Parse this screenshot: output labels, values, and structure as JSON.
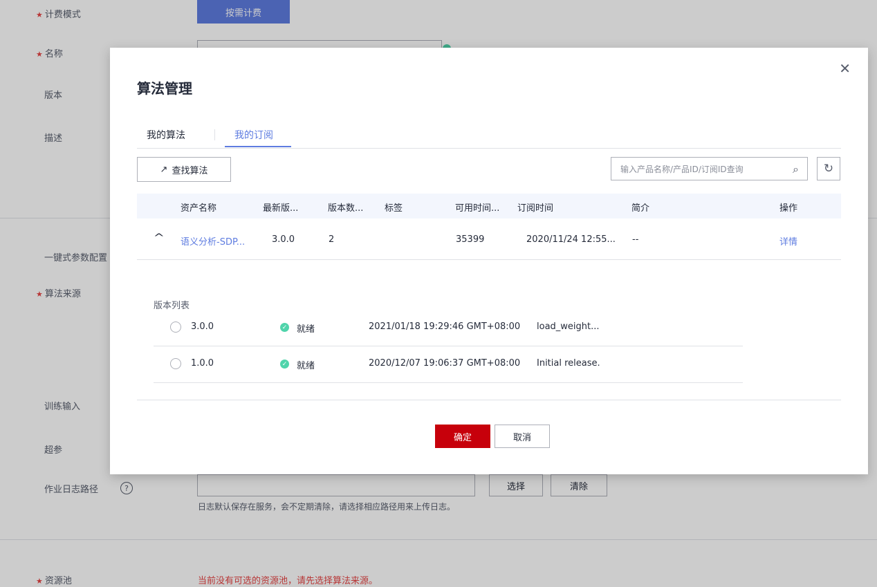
{
  "form": {
    "billing_label": "计费模式",
    "billing_button": "按需计费",
    "name_label": "名称",
    "version_label": "版本",
    "desc_label": "描述",
    "oneclick_label": "一键式参数配置",
    "algo_source_label": "算法来源",
    "train_input_label": "训练输入",
    "hyperparam_label": "超参",
    "log_path_label": "作业日志路径",
    "select_button": "选择",
    "clear_button": "清除",
    "log_hint": "日志默认保存在服务，会不定期清除，请选择相应路径用来上传日志。",
    "resource_pool_label": "资源池",
    "resource_pool_error": "当前没有可选的资源池，请先选择算法来源。"
  },
  "modal": {
    "title": "算法管理",
    "tabs": [
      {
        "label": "我的算法",
        "active": false
      },
      {
        "label": "我的订阅",
        "active": true
      }
    ],
    "find_button": "查找算法",
    "search_placeholder": "输入产品名称/产品ID/订阅ID查询",
    "columns": [
      "资产名称",
      "最新版...",
      "版本数...",
      "标签",
      "可用时间...",
      "订阅时间",
      "简介",
      "操作"
    ],
    "row": {
      "name": "语义分析-SDP...",
      "latest_version": "3.0.0",
      "version_count": "2",
      "tag": "",
      "available_time": "35399",
      "subscribe_time": "2020/11/24 12:55...",
      "intro": "--",
      "action": "详情"
    },
    "version_list_label": "版本列表",
    "versions": [
      {
        "version": "3.0.0",
        "status": "就绪",
        "time": "2021/01/18 19:29:46 GMT+08:00",
        "desc": "load_weight..."
      },
      {
        "version": "1.0.0",
        "status": "就绪",
        "time": "2020/12/07 19:06:37 GMT+08:00",
        "desc": "Initial release."
      }
    ],
    "ok_button": "确定",
    "cancel_button": "取消"
  },
  "colors": {
    "brand": "#5e7ce0",
    "danger": "#c7000b",
    "success": "#50d4ab"
  }
}
